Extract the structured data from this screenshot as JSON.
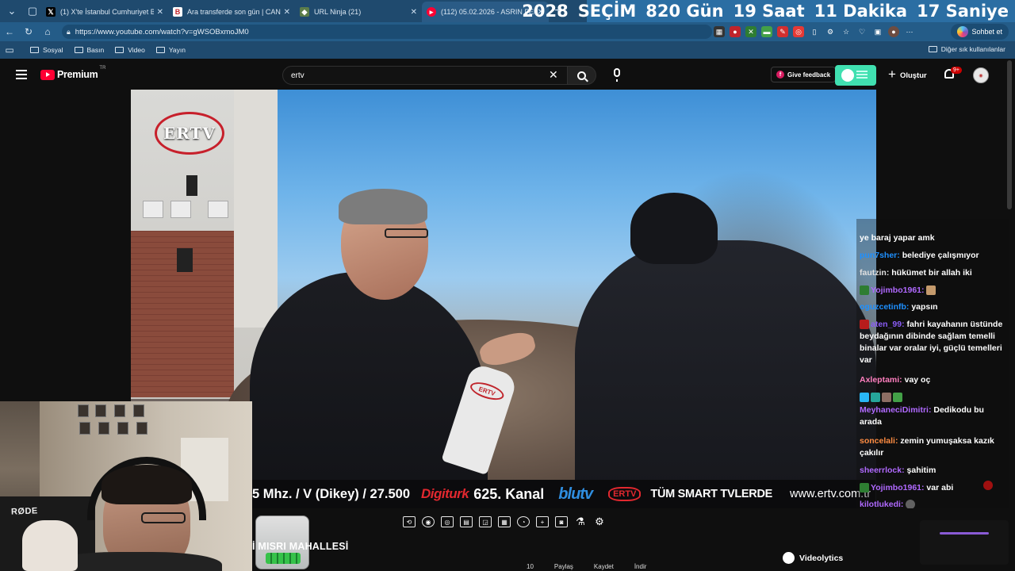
{
  "browser": {
    "tabs": [
      {
        "label": "(1) X'te İstanbul Cumhuriyet Başsa",
        "icon": "x-logo-icon",
        "active": false
      },
      {
        "label": "Ara transferde son gün | CANLI BL",
        "icon": "b-logo-icon",
        "active": false
      },
      {
        "label": "URL Ninja (21)",
        "icon": "ninja-icon",
        "active": false
      },
      {
        "label": "(112) 05.02.2026 - ASRIN FELAKET",
        "icon": "youtube-icon",
        "active": true
      }
    ],
    "new_tab": "+",
    "url": "https://www.youtube.com/watch?v=gWSOBxmoJM0",
    "chat_button": "Sohbet et",
    "bookmarks": [
      "Sosyal",
      "Basın",
      "Video",
      "Yayın"
    ],
    "other_bookmarks": "Diğer sık kullanılanlar"
  },
  "countdown": {
    "year": "2028",
    "label": "SEÇİM",
    "days": "820 Gün",
    "hours": "19 Saat",
    "minutes": "11 Dakika",
    "seconds": "17 Saniye"
  },
  "youtube": {
    "logo": "Premium",
    "region": "TR",
    "search_value": "ertv",
    "feedback": "Give feedback",
    "create": "Oluştur",
    "notifications": "9+"
  },
  "video": {
    "channel_logo": "ERTV",
    "mic_logo": "ERTV",
    "ticker": {
      "freq": "5 Mhz. / V (Dikey) / 27.500",
      "digiturk": "Digiturk",
      "kanal": "625. Kanal",
      "blutv": "blutv",
      "ertv_badge": "ERTV",
      "smart": "TÜM SMART TVLERDE",
      "url": "www.ertv.com.tr"
    },
    "title": "İ MISRI MAHALLESİ",
    "extension": "Videolytics",
    "actions": [
      "10",
      "Paylaş",
      "Kaydet",
      "İndir"
    ]
  },
  "webcam": {
    "mic_brand": "RØDE"
  },
  "chat": [
    {
      "user": "",
      "text": "ye baraj yapar amk",
      "color": "#ffffff"
    },
    {
      "user": "pun7sher:",
      "text": "belediye çalışmıyor",
      "color": "#1e90ff"
    },
    {
      "user": "fautzin:",
      "text": "hükümet bir allah iki",
      "color": "#e0e0e0"
    },
    {
      "user": "Yojimbo1961:",
      "text": "",
      "color": "#b069ff"
    },
    {
      "user": "oguzcetinfb:",
      "text": "yapsın",
      "color": "#1e90ff"
    },
    {
      "user": "aten_99:",
      "text": "fahri kayahanın üstünde beydağının dibinde sağlam temelli binalar var oralar iyi, güçlü temelleri var",
      "color": "#8a5cf6"
    },
    {
      "user": "Axleptami:",
      "text": "vay oç",
      "color": "#ff7fbf"
    },
    {
      "user": "",
      "text": "",
      "color": "#ffffff"
    },
    {
      "user": "MeyhaneciDimitri:",
      "text": "Dedikodu bu arada",
      "color": "#b069ff"
    },
    {
      "user": "soncelali:",
      "text": "zemin yumuşaksa kazık çakılır",
      "color": "#ff8c42"
    },
    {
      "user": "sheerrlock:",
      "text": "şahitim",
      "color": "#b069ff"
    },
    {
      "user": "Yojimbo1961:",
      "text": "var abi",
      "color": "#b069ff"
    },
    {
      "user": "kilotlukedi:",
      "text": "",
      "color": "#b069ff"
    }
  ],
  "colors": {
    "youtube_red": "#ff0033",
    "chrome_blue": "#1f4a6e",
    "countdown_bg": "#2b6ea3",
    "create_toggle": "#40e0b0"
  }
}
